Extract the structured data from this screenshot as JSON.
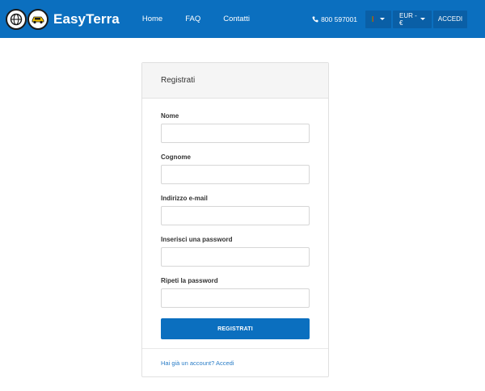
{
  "header": {
    "brand": "EasyTerra",
    "nav": [
      "Home",
      "FAQ",
      "Contatti"
    ],
    "phone": "800 597001",
    "currency": "EUR - €",
    "login": "ACCEDI"
  },
  "form": {
    "title": "Registrati",
    "fields": [
      {
        "label": "Nome",
        "value": ""
      },
      {
        "label": "Cognome",
        "value": ""
      },
      {
        "label": "Indirizzo e-mail",
        "value": ""
      },
      {
        "label": "Inserisci una password",
        "value": ""
      },
      {
        "label": "Ripeti la password",
        "value": ""
      }
    ],
    "submit": "REGISTRATI",
    "footer_link": "Hai già un account? Accedi"
  },
  "colors": {
    "primary": "#0b6fbf",
    "nav_button": "#0a5fa6",
    "link": "#2a7dc7"
  },
  "icons": [
    "globe-icon",
    "car-icon",
    "phone-icon",
    "italy-flag-icon",
    "caret-down-icon"
  ]
}
